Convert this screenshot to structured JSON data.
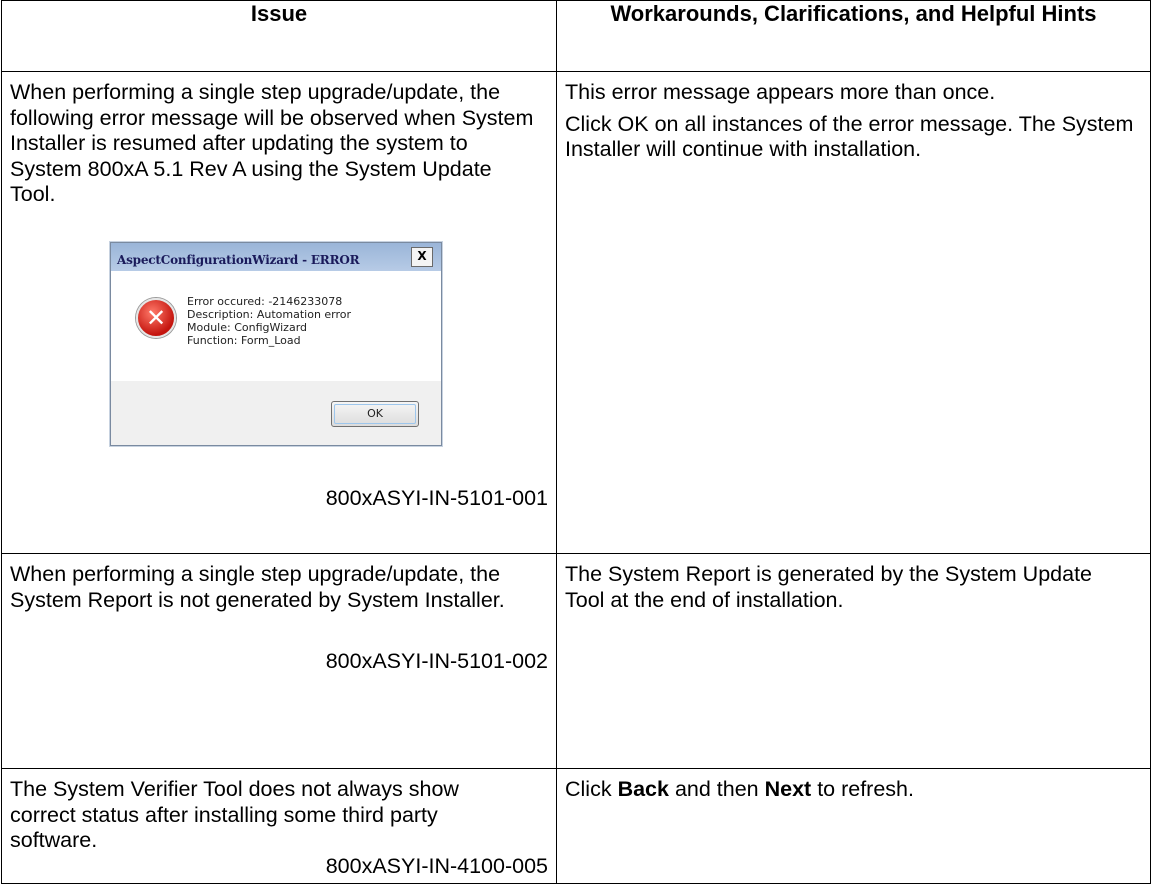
{
  "table": {
    "header_issue": "Issue",
    "header_workarounds": "Workarounds, Clarifications, and Helpful Hints"
  },
  "rows": [
    {
      "issue": "When performing a single step upgrade/update, the following error message will be observed when System Installer is resumed after updating the system to System 800xA 5.1 Rev A using the System Update Tool.",
      "id": "800xASYI-IN-5101-001",
      "workaround_lines": [
        "This error message appears more than once.",
        "Click OK on all instances of the error message. The System Installer will continue with installation."
      ],
      "dialog": {
        "title": "AspectConfigurationWizard - ERROR",
        "close": "X",
        "icon": "error-x-icon",
        "lines": [
          "Error occured: -2146233078",
          "Description: Automation error",
          "Module: ConfigWizard",
          "Function: Form_Load"
        ],
        "ok": "OK"
      }
    },
    {
      "issue": "When performing a single step upgrade/update, the System Report is not generated by System Installer.",
      "id": "800xASYI-IN-5101-002",
      "workaround": "The System Report is generated by the System Update Tool at the end of installation."
    },
    {
      "issue": "The System Verifier Tool does not always show correct status after installing some third party software.",
      "id": "800xASYI-IN-4100-005",
      "workaround_prefix": "Click ",
      "workaround_bold1": "Back",
      "workaround_mid": " and then ",
      "workaround_bold2": "Next",
      "workaround_suffix": " to refresh."
    }
  ]
}
